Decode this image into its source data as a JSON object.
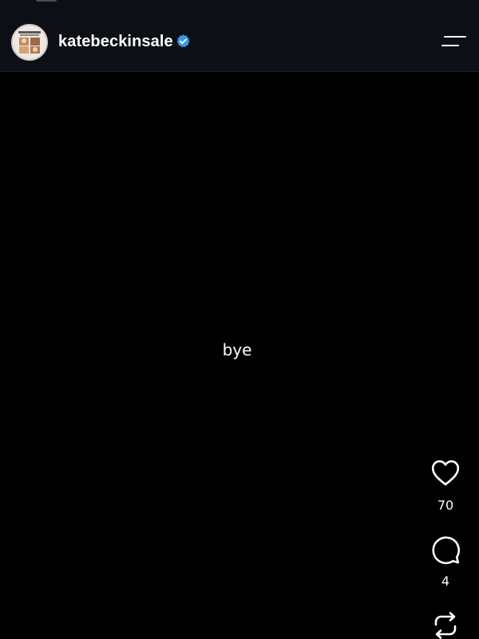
{
  "header": {
    "username": "katebeckinsale",
    "avatar_icon": "profile-photo-collage",
    "verified_icon": "verified-badge-icon",
    "verified_color": "#3897f0",
    "menu_icon": "hamburger-menu-icon"
  },
  "post": {
    "text": "bye"
  },
  "actions": {
    "like": {
      "icon": "heart-icon",
      "count": "70"
    },
    "comment": {
      "icon": "comment-bubble-icon",
      "count": "4"
    },
    "repost": {
      "icon": "repost-icon"
    }
  },
  "colors": {
    "header_background": "#0c0f16",
    "page_background": "#000000",
    "text": "#ffffff"
  }
}
